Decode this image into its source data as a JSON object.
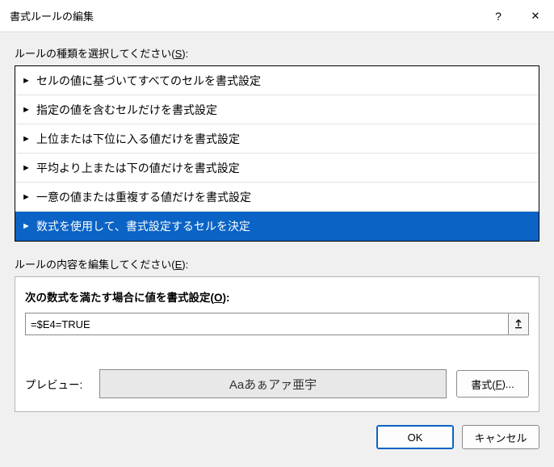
{
  "titlebar": {
    "title": "書式ルールの編集",
    "help": "?",
    "close": "✕"
  },
  "ruleTypeSection": {
    "label_pre": "ルールの種類を選択してください(",
    "accel": "S",
    "label_post": "):",
    "items": [
      {
        "text": "セルの値に基づいてすべてのセルを書式設定",
        "selected": false
      },
      {
        "text": "指定の値を含むセルだけを書式設定",
        "selected": false
      },
      {
        "text": "上位または下位に入る値だけを書式設定",
        "selected": false
      },
      {
        "text": "平均より上または下の値だけを書式設定",
        "selected": false
      },
      {
        "text": "一意の値または重複する値だけを書式設定",
        "selected": false
      },
      {
        "text": "数式を使用して、書式設定するセルを決定",
        "selected": true
      }
    ]
  },
  "ruleEditSection": {
    "label_pre": "ルールの内容を編集してください(",
    "accel": "E",
    "label_post": "):",
    "formula_caption_pre": "次の数式を満たす場合に値を書式設定(",
    "formula_accel": "O",
    "formula_caption_post": "):",
    "formula_value": "=$E4=TRUE",
    "preview_label": "プレビュー:",
    "preview_text": "Aaあぁアァ亜宇",
    "format_btn_pre": "書式(",
    "format_accel": "F",
    "format_btn_post": ")..."
  },
  "footer": {
    "ok": "OK",
    "cancel": "キャンセル"
  }
}
